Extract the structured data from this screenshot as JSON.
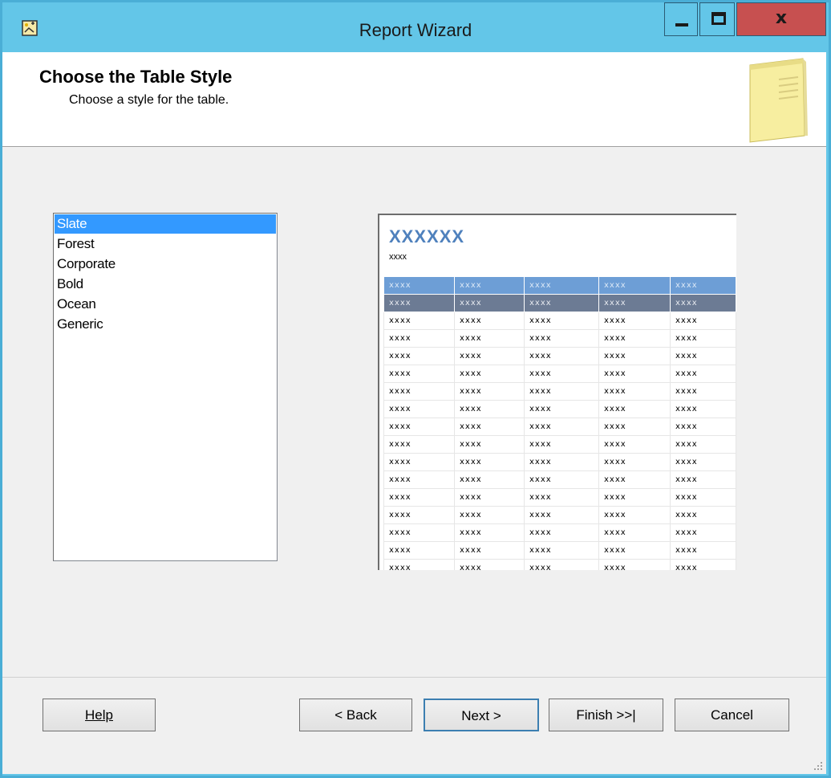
{
  "window": {
    "title": "Report Wizard",
    "close_glyph": "x"
  },
  "header": {
    "title": "Choose the Table Style",
    "subtitle": "Choose a style for the table."
  },
  "styles": {
    "items": [
      "Slate",
      "Forest",
      "Corporate",
      "Bold",
      "Ocean",
      "Generic"
    ],
    "selected": "Slate"
  },
  "preview": {
    "title": "XXXXXX",
    "subtitle": "xxxx",
    "cell": "xxxx"
  },
  "buttons": {
    "help": "Help",
    "back": "< Back",
    "next": "Next >",
    "finish": "Finish >>|",
    "cancel": "Cancel"
  },
  "colors": {
    "titlebar": "#63c6e8",
    "close": "#c75050",
    "selection": "#3399ff",
    "preview_header": "#6d9ed6",
    "preview_subheader": "#6c7b94",
    "preview_title": "#4f81bd"
  }
}
